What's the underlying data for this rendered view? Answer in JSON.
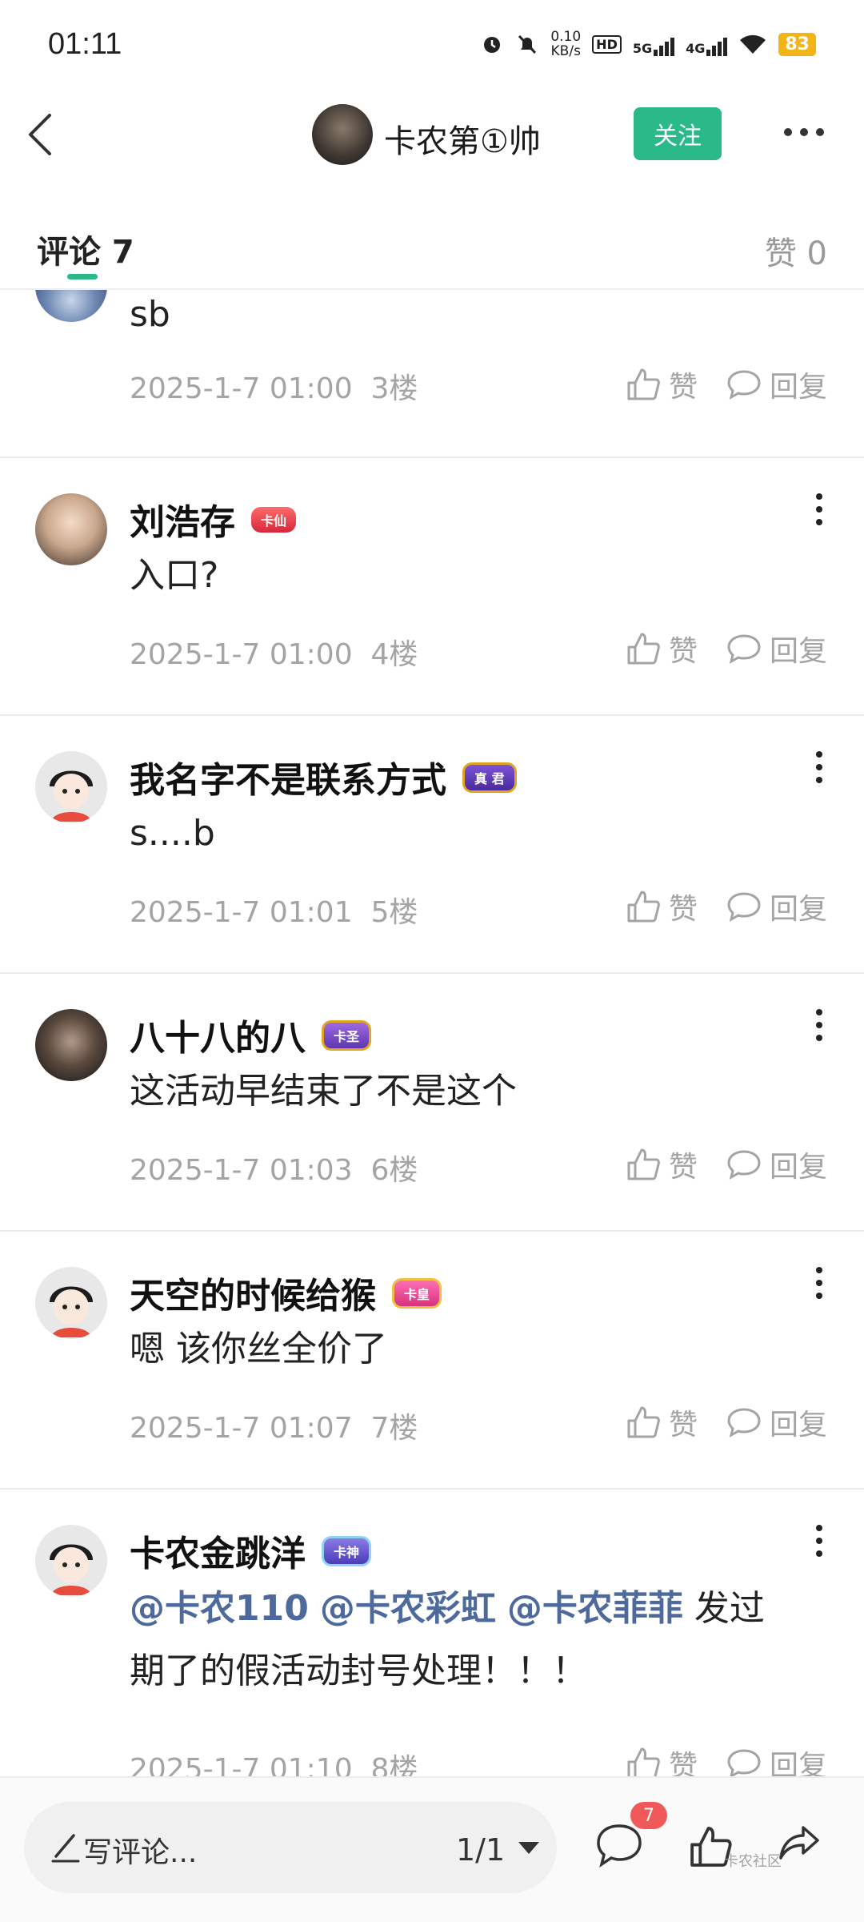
{
  "status_bar": {
    "time": "01:11",
    "net_speed_value": "0.10",
    "net_speed_unit": "KB/s",
    "hd_label": "HD",
    "signal_1": "5G",
    "signal_2": "4G",
    "battery": "83"
  },
  "header": {
    "author_name": "卡农第①帅",
    "follow_label": "关注"
  },
  "tabs": {
    "comments_label": "评论 7",
    "likes_label": "赞 0"
  },
  "comments": [
    {
      "name": "",
      "text": "sb",
      "date": "2025-1-7 01:00",
      "floor": "3楼",
      "like_label": "赞",
      "reply_label": "回复"
    },
    {
      "name": "刘浩存",
      "badge": "卡仙",
      "text": "入口?",
      "date": "2025-1-7 01:00",
      "floor": "4楼",
      "like_label": "赞",
      "reply_label": "回复"
    },
    {
      "name": "我名字不是联系方式",
      "badge": "真 君",
      "text": "s....b",
      "date": "2025-1-7 01:01",
      "floor": "5楼",
      "like_label": "赞",
      "reply_label": "回复"
    },
    {
      "name": "八十八的八",
      "badge": "卡圣",
      "text": "这活动早结束了不是这个",
      "date": "2025-1-7 01:03",
      "floor": "6楼",
      "like_label": "赞",
      "reply_label": "回复"
    },
    {
      "name": "天空的时候给猴",
      "badge": "卡皇",
      "text": "嗯 该你丝全价了",
      "date": "2025-1-7 01:07",
      "floor": "7楼",
      "like_label": "赞",
      "reply_label": "回复"
    },
    {
      "name": "卡农金跳洋",
      "badge": "卡神",
      "mentions": [
        "@卡农110",
        "@卡农彩虹",
        "@卡农菲菲"
      ],
      "text_line1_tail": "发过",
      "text_line2": "期了的假活动封号处理！！！",
      "date": "2025-1-7 01:10",
      "floor": "8楼",
      "like_label": "赞",
      "reply_label": "回复"
    }
  ],
  "bottom_bar": {
    "write_placeholder": "写评论...",
    "page_indicator": "1/1",
    "comment_count": "7",
    "watermark": "卡农社区"
  },
  "colors": {
    "accent_green": "#2bb98a",
    "mention_blue": "#4e6a9c",
    "badge_red": "#f0595a",
    "battery": "#f2b417"
  }
}
